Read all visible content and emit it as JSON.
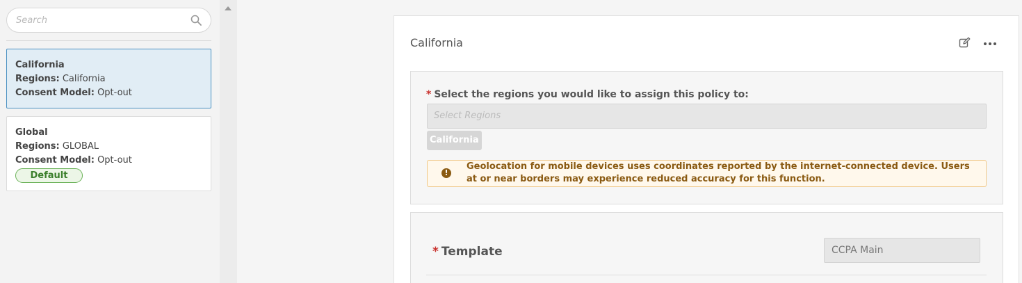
{
  "search": {
    "placeholder": "Search"
  },
  "policies": [
    {
      "name": "California",
      "regions_label": "Regions:",
      "regions_value": "California",
      "consent_label": "Consent Model:",
      "consent_value": "Opt-out",
      "selected": true
    },
    {
      "name": "Global",
      "regions_label": "Regions:",
      "regions_value": "GLOBAL",
      "consent_label": "Consent Model:",
      "consent_value": "Opt-out",
      "badge": "Default"
    }
  ],
  "detail": {
    "title": "California",
    "regions": {
      "required_mark": "*",
      "label": "Select the regions you would like to assign this policy to:",
      "placeholder": "Select Regions",
      "selected_tags": [
        "California"
      ],
      "warning_icon": "!",
      "warning": "Geolocation for mobile devices uses coordinates reported by the internet-connected device. Users at or near borders may experience reduced accuracy for this function."
    },
    "template": {
      "required_mark": "*",
      "label": "Template",
      "value": "CCPA Main"
    }
  },
  "icons": {
    "search": "search-icon",
    "edit": "edit-icon",
    "more": "more-options-icon",
    "warning": "warning-icon",
    "scroll_up": "scroll-up-arrow-icon"
  },
  "colors": {
    "selected_bg": "#e1edf5",
    "selected_border": "#4a90c2",
    "required": "#c9302c",
    "warning_text": "#8a5a12",
    "warning_bg": "#fff8ec",
    "default_badge_border": "#6cb35a"
  }
}
